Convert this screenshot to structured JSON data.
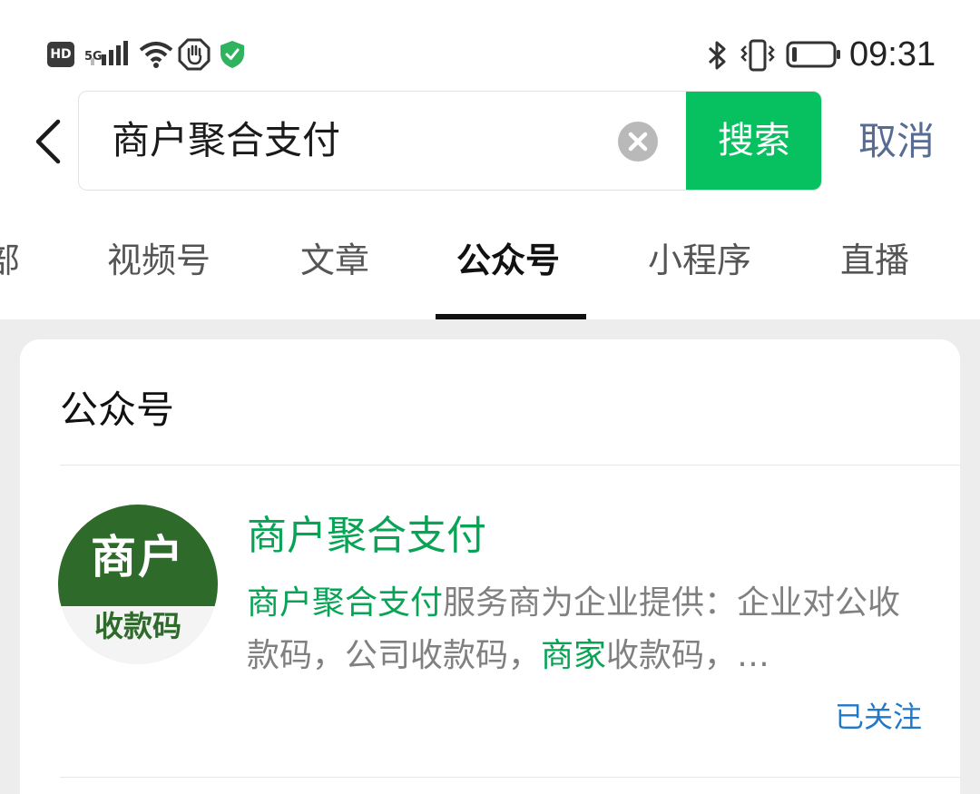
{
  "status_bar": {
    "hd": "HD",
    "network": "5G",
    "time": "09:31",
    "icons": [
      "signal-icon",
      "wifi-icon",
      "hand-icon",
      "shield-check-icon",
      "bluetooth-icon",
      "vibrate-icon",
      "battery-icon"
    ],
    "battery_level": 0.12
  },
  "search": {
    "query": "商户聚合支付",
    "button": "搜索",
    "cancel": "取消"
  },
  "tabs": [
    {
      "label": "部"
    },
    {
      "label": "视频号"
    },
    {
      "label": "文章"
    },
    {
      "label": "公众号",
      "active": true
    },
    {
      "label": "小程序"
    },
    {
      "label": "直播"
    }
  ],
  "result": {
    "section_title": "公众号",
    "avatar": {
      "line1": "商户",
      "line2": "收款码"
    },
    "name": "商户聚合支付",
    "desc_parts": [
      {
        "text": "商户聚合支付",
        "highlight": true
      },
      {
        "text": "服务商为企业提供：企业对公收款码，公司收款码，",
        "highlight": false
      },
      {
        "text": "商家",
        "highlight": true
      },
      {
        "text": "收款码，…",
        "highlight": false
      }
    ],
    "follow_status": "已关注"
  },
  "colors": {
    "accent_green": "#07c160",
    "highlight_green": "#07a455",
    "link_blue": "#576b95",
    "follow_blue": "#1f78c8",
    "avatar_green": "#2e6b2a"
  }
}
